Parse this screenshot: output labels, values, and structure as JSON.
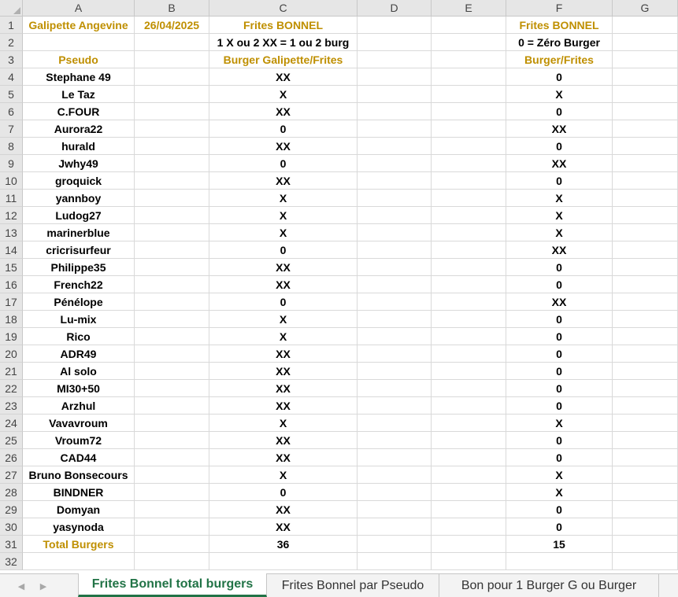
{
  "columns": [
    "A",
    "B",
    "C",
    "D",
    "E",
    "F",
    "G"
  ],
  "rows": [
    {
      "num": "1",
      "cells": [
        "Galipette Angevine",
        "26/04/2025",
        "Frites BONNEL",
        "",
        "",
        "Frites BONNEL",
        ""
      ]
    },
    {
      "num": "2",
      "cells": [
        "",
        "",
        "1 X ou 2 XX = 1 ou 2 burg",
        "",
        "",
        "0 = Zéro Burger",
        ""
      ]
    },
    {
      "num": "3",
      "cells": [
        "Pseudo",
        "",
        "Burger Galipette/Frites",
        "",
        "",
        "Burger/Frites",
        ""
      ]
    },
    {
      "num": "4",
      "cells": [
        "Stephane 49",
        "",
        "XX",
        "",
        "",
        "0",
        ""
      ]
    },
    {
      "num": "5",
      "cells": [
        "Le Taz",
        "",
        "X",
        "",
        "",
        "X",
        ""
      ]
    },
    {
      "num": "6",
      "cells": [
        "C.FOUR",
        "",
        "XX",
        "",
        "",
        "0",
        ""
      ]
    },
    {
      "num": "7",
      "cells": [
        "Aurora22",
        "",
        "0",
        "",
        "",
        "XX",
        ""
      ]
    },
    {
      "num": "8",
      "cells": [
        "hurald",
        "",
        "XX",
        "",
        "",
        "0",
        ""
      ]
    },
    {
      "num": "9",
      "cells": [
        "Jwhy49",
        "",
        "0",
        "",
        "",
        "XX",
        ""
      ]
    },
    {
      "num": "10",
      "cells": [
        "groquick",
        "",
        "XX",
        "",
        "",
        "0",
        ""
      ]
    },
    {
      "num": "11",
      "cells": [
        "yannboy",
        "",
        "X",
        "",
        "",
        "X",
        ""
      ]
    },
    {
      "num": "12",
      "cells": [
        "Ludog27",
        "",
        "X",
        "",
        "",
        "X",
        ""
      ]
    },
    {
      "num": "13",
      "cells": [
        "marinerblue",
        "",
        "X",
        "",
        "",
        "X",
        ""
      ]
    },
    {
      "num": "14",
      "cells": [
        "cricrisurfeur",
        "",
        "0",
        "",
        "",
        "XX",
        ""
      ]
    },
    {
      "num": "15",
      "cells": [
        "Philippe35",
        "",
        "XX",
        "",
        "",
        "0",
        ""
      ]
    },
    {
      "num": "16",
      "cells": [
        "French22",
        "",
        "XX",
        "",
        "",
        "0",
        ""
      ]
    },
    {
      "num": "17",
      "cells": [
        "Pénélope",
        "",
        "0",
        "",
        "",
        "XX",
        ""
      ]
    },
    {
      "num": "18",
      "cells": [
        "Lu-mix",
        "",
        "X",
        "",
        "",
        "0",
        ""
      ]
    },
    {
      "num": "19",
      "cells": [
        "Rico",
        "",
        "X",
        "",
        "",
        "0",
        ""
      ]
    },
    {
      "num": "20",
      "cells": [
        "ADR49",
        "",
        "XX",
        "",
        "",
        "0",
        ""
      ]
    },
    {
      "num": "21",
      "cells": [
        "Al solo",
        "",
        "XX",
        "",
        "",
        "0",
        ""
      ]
    },
    {
      "num": "22",
      "cells": [
        "MI30+50",
        "",
        "XX",
        "",
        "",
        "0",
        ""
      ]
    },
    {
      "num": "23",
      "cells": [
        "Arzhul",
        "",
        "XX",
        "",
        "",
        "0",
        ""
      ]
    },
    {
      "num": "24",
      "cells": [
        "Vavavroum",
        "",
        "X",
        "",
        "",
        "X",
        ""
      ]
    },
    {
      "num": "25",
      "cells": [
        "Vroum72",
        "",
        "XX",
        "",
        "",
        "0",
        ""
      ]
    },
    {
      "num": "26",
      "cells": [
        "CAD44",
        "",
        "XX",
        "",
        "",
        "0",
        ""
      ]
    },
    {
      "num": "27",
      "cells": [
        "Bruno Bonsecours",
        "",
        "X",
        "",
        "",
        "X",
        ""
      ]
    },
    {
      "num": "28",
      "cells": [
        "BINDNER",
        "",
        "0",
        "",
        "",
        "X",
        ""
      ]
    },
    {
      "num": "29",
      "cells": [
        "Domyan",
        "",
        "XX",
        "",
        "",
        "0",
        ""
      ]
    },
    {
      "num": "30",
      "cells": [
        "yasynoda",
        "",
        "XX",
        "",
        "",
        "0",
        ""
      ]
    },
    {
      "num": "31",
      "cells": [
        "Total Burgers",
        "",
        "36",
        "",
        "",
        "15",
        ""
      ]
    },
    {
      "num": "32",
      "cells": [
        "",
        "",
        "",
        "",
        "",
        "",
        ""
      ]
    }
  ],
  "tabs": [
    {
      "label": "Frites Bonnel total burgers",
      "active": true
    },
    {
      "label": "Frites Bonnel par Pseudo",
      "active": false
    },
    {
      "label": "Bon pour 1 Burger G ou Burger",
      "active": false
    }
  ],
  "colors": {
    "header_gold": "#bf8f00",
    "active_tab": "#217346",
    "header_bg": "#e6e6e6",
    "gridline": "#d9d9d9"
  },
  "icons": [
    "nav-left-icon",
    "nav-right-icon"
  ]
}
